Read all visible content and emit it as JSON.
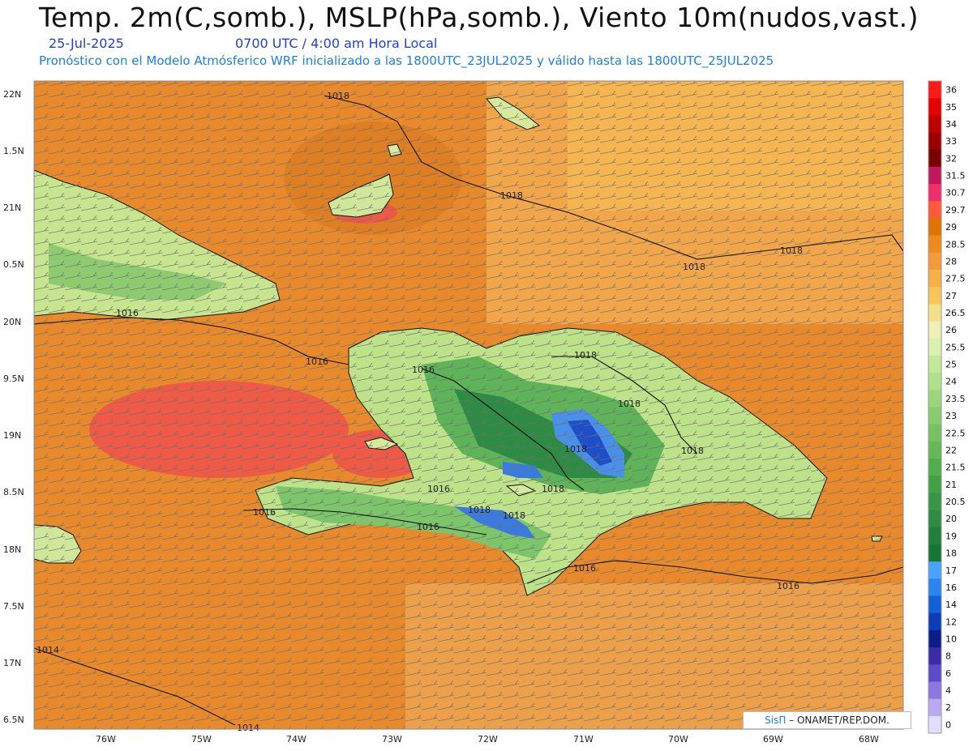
{
  "header": {
    "title": "Temp. 2m(C,somb.), MSLP(hPa,somb.), Viento 10m(nudos,vast.)",
    "date": "25-Jul-2025",
    "time": "0700 UTC / 4:00 am Hora Local",
    "subtitle": "Pronóstico con el Modelo Atmósferico WRF inicializado a las 1800UTC_23JUL2025 y válido hasta las  1800UTC_25JUL2025"
  },
  "axes": {
    "lat_labels": [
      "22N",
      "1.5N",
      "21N",
      "0.5N",
      "20N",
      "9.5N",
      "19N",
      "8.5N",
      "18N",
      "7.5N",
      "17N",
      "6.5N"
    ],
    "lon_labels": [
      "76W",
      "75W",
      "74W",
      "73W",
      "72W",
      "71W",
      "70W",
      "69W",
      "68W"
    ]
  },
  "isobars": {
    "labels": [
      "1018",
      "1018",
      "1018",
      "1018",
      "1016",
      "1016",
      "1016",
      "1018",
      "1018",
      "1018",
      "1018",
      "1018",
      "1016",
      "1018",
      "1016",
      "1018",
      "1016",
      "1016",
      "1016",
      "1014",
      "1014"
    ]
  },
  "colorbar": {
    "labels": [
      "36",
      "35",
      "34",
      "33",
      "32",
      "31.5",
      "30.7",
      "29.7",
      "29",
      "28.5",
      "28",
      "27.5",
      "27",
      "26.5",
      "26",
      "25.5",
      "25",
      "24",
      "23.5",
      "23",
      "22.5",
      "22",
      "21.5",
      "21",
      "20.5",
      "20",
      "19",
      "18",
      "17",
      "16",
      "14",
      "12",
      "10",
      "8",
      "6",
      "4",
      "2",
      "0"
    ],
    "colors": [
      "#ff1a1a",
      "#e60000",
      "#c00000",
      "#9b0000",
      "#7a0000",
      "#c2185b",
      "#f0306a",
      "#ff5a3a",
      "#e07400",
      "#ef8a1f",
      "#f29a3c",
      "#f5b04a",
      "#f8c55a",
      "#f2e08a",
      "#eef0b8",
      "#d8f0b0",
      "#c2e89a",
      "#b0e08a",
      "#9cd67c",
      "#88cc6e",
      "#76c263",
      "#64b858",
      "#52ad4e",
      "#43a047",
      "#38954a",
      "#2e8b44",
      "#22803c",
      "#177535",
      "#4aa3ff",
      "#2a86ee",
      "#1560d8",
      "#0b3fb8",
      "#0a1e8a",
      "#3b2da8",
      "#5e4bc8",
      "#8a78e0",
      "#b8aaf0",
      "#e2dcff"
    ]
  },
  "watermark": {
    "sis": "SisΠ",
    "org": "– ONAMET/REP.DOM."
  }
}
